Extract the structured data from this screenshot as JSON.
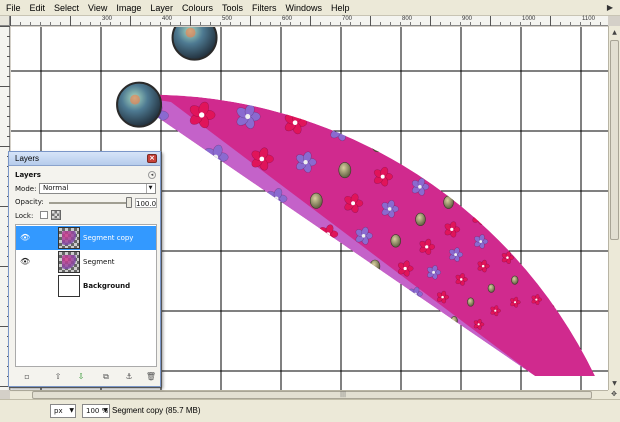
{
  "menubar": {
    "items": [
      "File",
      "Edit",
      "Select",
      "View",
      "Image",
      "Layer",
      "Colours",
      "Tools",
      "Filters",
      "Windows",
      "Help"
    ]
  },
  "ruler_top": {
    "labels": [
      "300",
      "400",
      "500",
      "600",
      "700",
      "800",
      "900",
      "1000",
      "1100"
    ]
  },
  "statusbar": {
    "unit": "px",
    "zoom": "100 %",
    "message": "Segment copy (85.7 MB)"
  },
  "layers_dialog": {
    "title": "Layers",
    "tab_label": "Layers",
    "mode_label": "Mode:",
    "mode_value": "Normal",
    "opacity_label": "Opacity:",
    "opacity_value": "100.0",
    "opacity_level": 1.0,
    "lock_label": "Lock:",
    "layers": [
      {
        "name": "Segment copy",
        "selected": true,
        "visible": true
      },
      {
        "name": "Segment",
        "selected": false,
        "visible": true
      },
      {
        "name": "Background",
        "selected": false,
        "visible": false
      }
    ]
  },
  "colors": {
    "selection": "#3399ff",
    "petal_magenta": "#e0145a",
    "petal_violet": "#8a6ad0",
    "background_pink": "#d02a8e",
    "edge_violet": "#c070d8"
  }
}
